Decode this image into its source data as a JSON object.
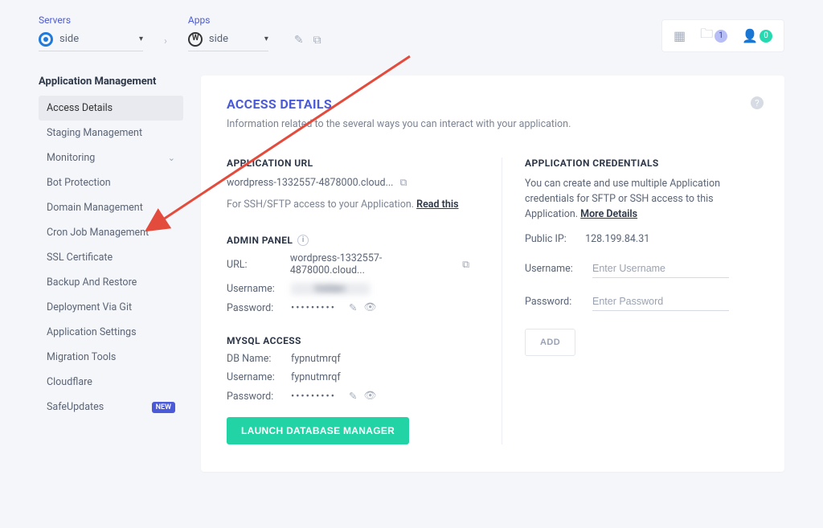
{
  "breadcrumbs": {
    "servers_label": "Servers",
    "server_selected": "side",
    "apps_label": "Apps",
    "app_selected": "side"
  },
  "topbar": {
    "folder_badge": "1",
    "user_badge": "0"
  },
  "sidebar": {
    "heading": "Application Management",
    "items": [
      {
        "label": "Access Details",
        "active": true
      },
      {
        "label": "Staging Management"
      },
      {
        "label": "Monitoring",
        "expandable": true
      },
      {
        "label": "Bot Protection"
      },
      {
        "label": "Domain Management"
      },
      {
        "label": "Cron Job Management"
      },
      {
        "label": "SSL Certificate"
      },
      {
        "label": "Backup And Restore"
      },
      {
        "label": "Deployment Via Git"
      },
      {
        "label": "Application Settings"
      },
      {
        "label": "Migration Tools"
      },
      {
        "label": "Cloudflare"
      },
      {
        "label": "SafeUpdates",
        "tag": "NEW"
      }
    ]
  },
  "panel": {
    "title": "ACCESS DETAILS",
    "subtitle": "Information related to the several ways you can interact with your application.",
    "app_url_heading": "APPLICATION URL",
    "app_url_value": "wordpress-1332557-4878000.cloud...",
    "app_url_hint_prefix": "For SSH/SFTP access to your Application. ",
    "app_url_hint_link": "Read this",
    "admin_heading": "ADMIN PANEL",
    "admin_url_label": "URL:",
    "admin_url_value": "wordpress-1332557-4878000.cloud...",
    "admin_user_label": "Username:",
    "admin_user_value": "hidden",
    "admin_pass_label": "Password:",
    "admin_pass_value": "•••••••••",
    "mysql_heading": "MYSQL ACCESS",
    "mysql_db_label": "DB Name:",
    "mysql_db_value": "fypnutmrqf",
    "mysql_user_label": "Username:",
    "mysql_user_value": "fypnutmrqf",
    "mysql_pass_label": "Password:",
    "mysql_pass_value": "•••••••••",
    "launch_db_btn": "LAUNCH DATABASE MANAGER",
    "cred_heading": "APPLICATION CREDENTIALS",
    "cred_desc": "You can create and use multiple Application credentials for SFTP or SSH access to this Application. ",
    "cred_more": "More Details",
    "public_ip_label": "Public IP:",
    "public_ip_value": "128.199.84.31",
    "cred_user_label": "Username:",
    "cred_user_placeholder": "Enter Username",
    "cred_pass_label": "Password:",
    "cred_pass_placeholder": "Enter Password",
    "add_btn": "ADD"
  }
}
